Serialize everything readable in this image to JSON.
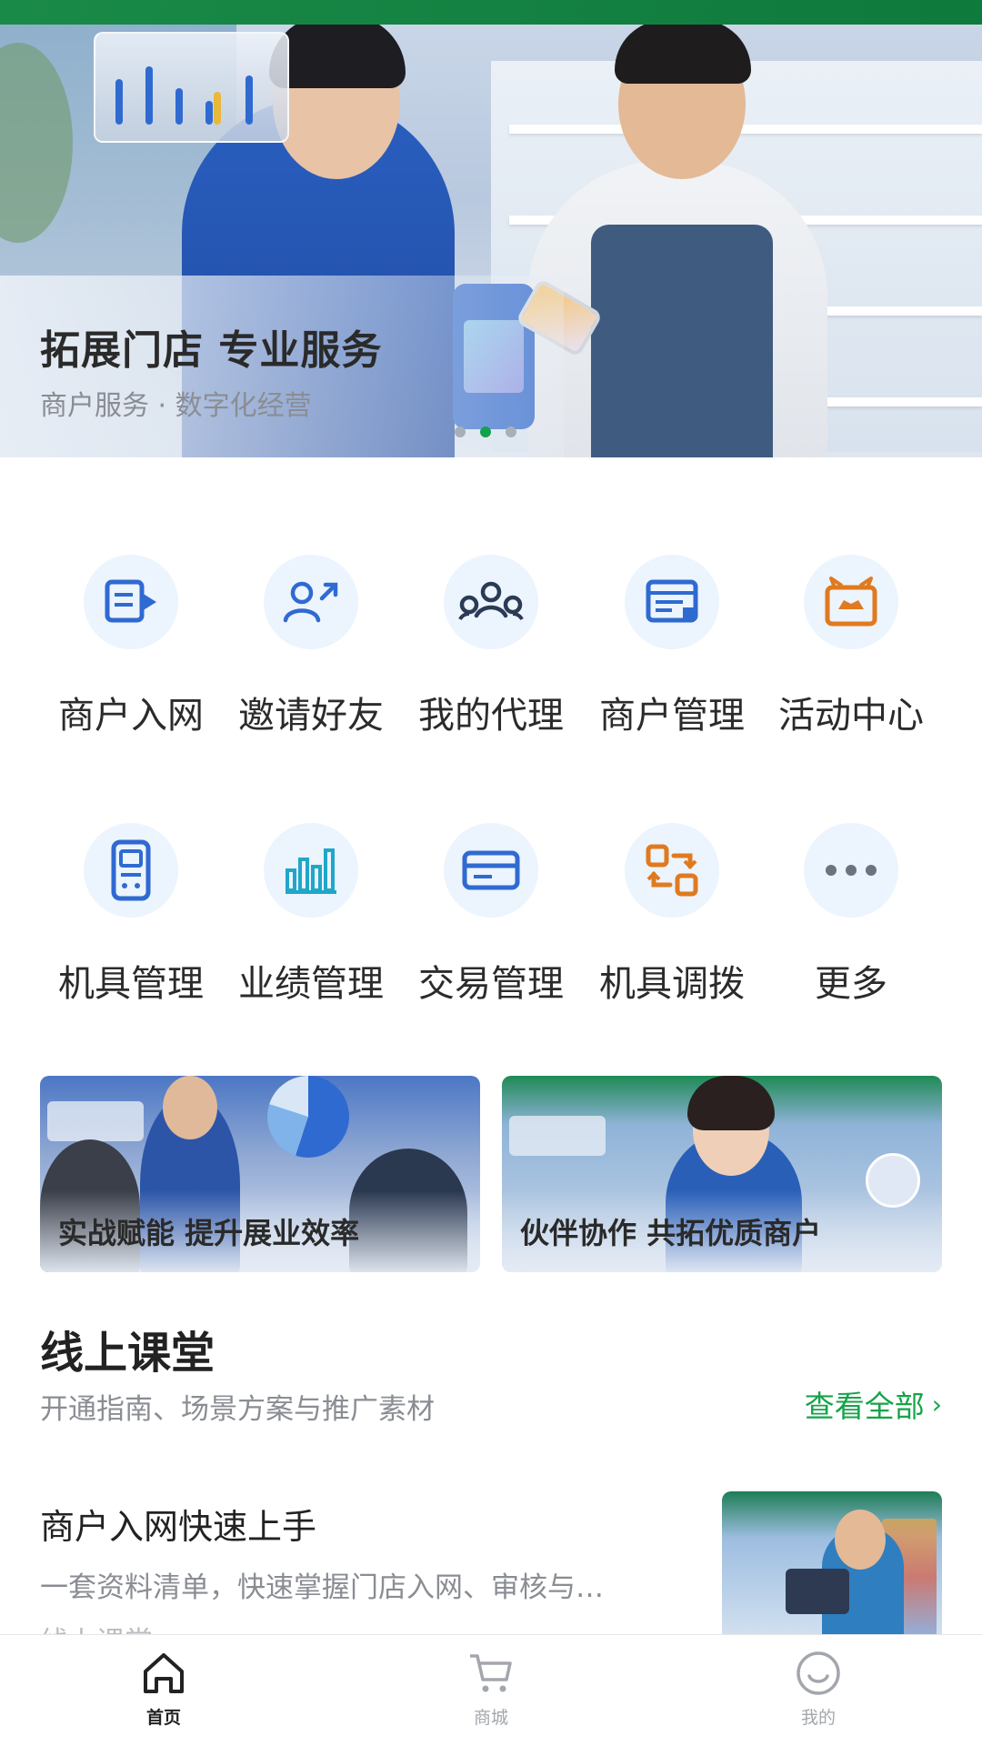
{
  "banner": {
    "title": "拓展门店 专业服务",
    "subtitle": "商户服务 · 数字化经营",
    "dots": 3,
    "active_dot": 1
  },
  "services": [
    {
      "label": "商户入网",
      "icon": "merchant-onboard-icon",
      "color": "#2f6ad1"
    },
    {
      "label": "邀请好友",
      "icon": "invite-friend-icon",
      "color": "#2f6ad1"
    },
    {
      "label": "我的代理",
      "icon": "agents-icon",
      "color": "#2b3a55"
    },
    {
      "label": "商户管理",
      "icon": "merchant-manage-icon",
      "color": "#2f6ad1"
    },
    {
      "label": "活动中心",
      "icon": "activity-center-icon",
      "color": "#e07a1f"
    },
    {
      "label": "机具管理",
      "icon": "device-manage-icon",
      "color": "#2f6ad1"
    },
    {
      "label": "业绩管理",
      "icon": "performance-icon",
      "color": "#1fa7c9"
    },
    {
      "label": "交易管理",
      "icon": "transaction-icon",
      "color": "#2f6ad1"
    },
    {
      "label": "机具调拨",
      "icon": "device-transfer-icon",
      "color": "#e07a1f"
    },
    {
      "label": "更多",
      "icon": "more-icon",
      "color": "#6b7280"
    }
  ],
  "promos": [
    {
      "text": "实战赋能 提升展业效率"
    },
    {
      "text": "伙伴协作 共拓优质商户"
    }
  ],
  "classroom": {
    "title": "线上课堂",
    "subtitle": "开通指南、场景方案与推广素材",
    "see_all": "查看全部",
    "courses": [
      {
        "title": "商户入网快速上手",
        "desc": "一套资料清单，快速掌握门店入网、审核与…",
        "tag": "线上课堂"
      }
    ]
  },
  "nav": {
    "items": [
      {
        "label": "首页",
        "icon": "home-icon",
        "active": true
      },
      {
        "label": "商城",
        "icon": "cart-icon",
        "active": false
      },
      {
        "label": "我的",
        "icon": "profile-icon",
        "active": false
      }
    ]
  },
  "colors": {
    "accent": "#16a34a",
    "brand_blue": "#2f6ad1",
    "icon_bg": "#ecf4fd"
  }
}
